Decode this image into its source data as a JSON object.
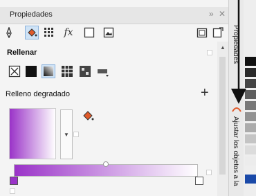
{
  "panel": {
    "title": "Propiedades",
    "collapse_glyph": "»",
    "close_glyph": "✕"
  },
  "toolbar": {
    "icons": [
      "outline-pen-icon",
      "fill-bucket-icon",
      "pattern-icon",
      "fx-icon",
      "frame-icon",
      "image-icon",
      "copy-frame-icon",
      "copy-settings-icon"
    ],
    "fx_label": "fx"
  },
  "fill_section": {
    "label": "Rellenar",
    "types": [
      "no-fill-icon",
      "uniform-fill-icon",
      "fountain-fill-icon",
      "vector-pattern-icon",
      "bitmap-pattern-icon",
      "texture-fill-icon"
    ]
  },
  "gradient_section": {
    "label": "Relleno degradado",
    "add_glyph": "+",
    "start_color": "#9a33c8",
    "end_color": "#ffffff"
  },
  "side_tabs": {
    "properties": "Propiedades",
    "align": "Ajustar los objetos a la"
  },
  "colors": {
    "accent": "#9a33c8",
    "selected_tool": "#cfe3f6"
  }
}
